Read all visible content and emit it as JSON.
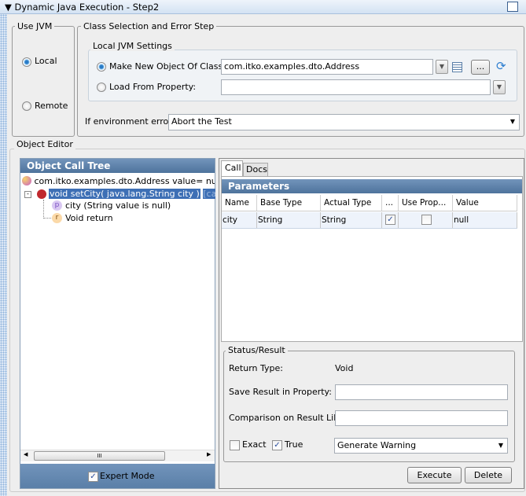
{
  "window": {
    "title": "Dynamic Java Execution - Step2"
  },
  "use_jvm": {
    "label": "Use JVM",
    "local": "Local",
    "remote": "Remote",
    "selected": "Local"
  },
  "class_selection": {
    "label": "Class Selection and Error Step",
    "local_settings": {
      "label": "Local JVM Settings",
      "make_new_label": "Make New Object Of Class:",
      "make_new_value": "com.itko.examples.dto.Address",
      "load_label": "Load From Property:",
      "load_value": "",
      "browse_label": "...",
      "selected": "Make New Object Of Class"
    },
    "env_error_label": "If environment error:",
    "env_error_value": "Abort the Test"
  },
  "object_editor": {
    "label": "Object Editor",
    "tree": {
      "header": "Object Call Tree",
      "root": "com.itko.examples.dto.Address value=  null, null",
      "method": "void setCity( java.lang.String city )",
      "method_suffix": "[call not executed]",
      "param": "city (String value is null)",
      "ret": "Void return",
      "scroll_grip": "III",
      "expert_mode": "Expert Mode",
      "expert_checked": true
    },
    "tabs": [
      {
        "label": "Call",
        "active": true
      },
      {
        "label": "Docs",
        "active": false
      }
    ],
    "parameters": {
      "header": "Parameters",
      "columns": [
        "Name",
        "Base Type",
        "Actual Type",
        "...",
        "Use Prop...",
        "Value"
      ],
      "rows": [
        {
          "name": "city",
          "base_type": "String",
          "actual_type": "String",
          "dots_checked": true,
          "use_prop": false,
          "value": "null"
        }
      ]
    },
    "status": {
      "label": "Status/Result",
      "return_type_label": "Return Type:",
      "return_type_value": "Void",
      "save_label": "Save Result in Property:",
      "save_value": "",
      "compare_label": "Comparison on Result Like:",
      "compare_value": "",
      "exact_label": "Exact",
      "exact_checked": false,
      "true_label": "True",
      "true_checked": true,
      "action_value": "Generate Warning"
    },
    "buttons": {
      "execute": "Execute",
      "delete": "Delete"
    }
  },
  "colors": {
    "header_blue": "#5a7fa8",
    "selection": "#3d6fb5"
  }
}
